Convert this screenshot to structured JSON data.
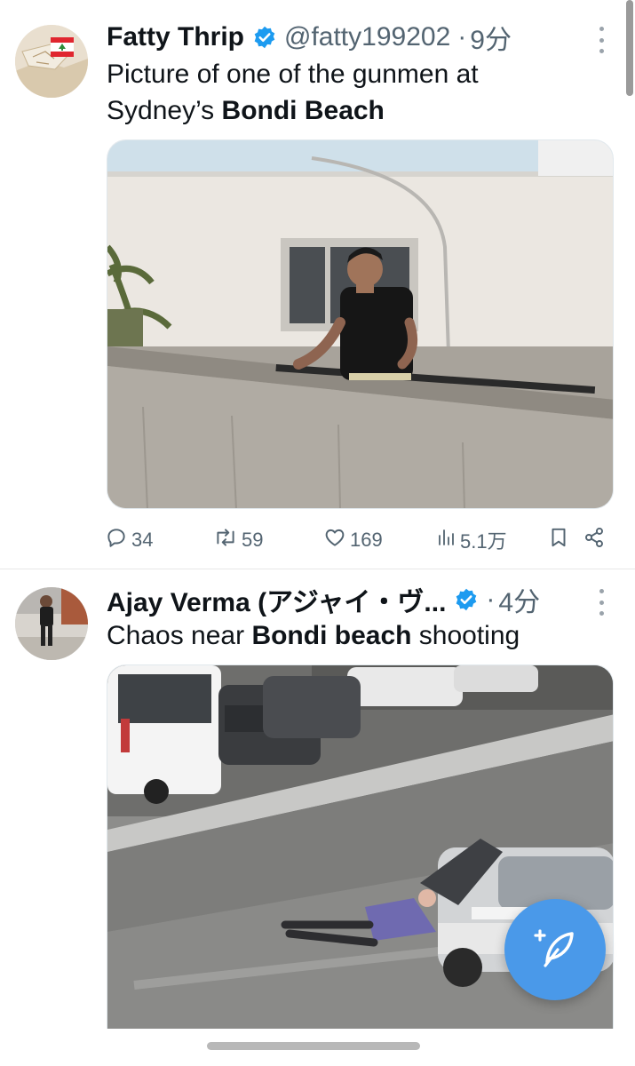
{
  "tweets": [
    {
      "display_name": "Fatty Thrip",
      "handle": "@fatty199202",
      "separator": "·",
      "time": "9分",
      "text_line1": "Picture of one of the gunmen at",
      "text_line2_plain": "Sydney’s ",
      "text_line2_bold": "Bondi Beach",
      "stats": {
        "replies": "34",
        "reposts": "59",
        "likes": "169",
        "views": "5.1万"
      }
    },
    {
      "display_name": "Ajay Verma (アジャイ・ヴ...",
      "separator": "·",
      "time": "4分",
      "text_plain_before": "Chaos near ",
      "text_bold": "Bondi beach",
      "text_plain_after": " shooting"
    }
  ],
  "colors": {
    "accent": "#1d9bf0",
    "fab": "#4a99e9",
    "muted_text": "#536471"
  },
  "icons": {
    "verified": "verified-badge-icon",
    "more": "more-vertical-icon",
    "reply": "reply-icon",
    "repost": "repost-icon",
    "like": "heart-icon",
    "views": "views-icon",
    "bookmark": "bookmark-icon",
    "share": "share-icon",
    "compose": "compose-post-icon"
  }
}
